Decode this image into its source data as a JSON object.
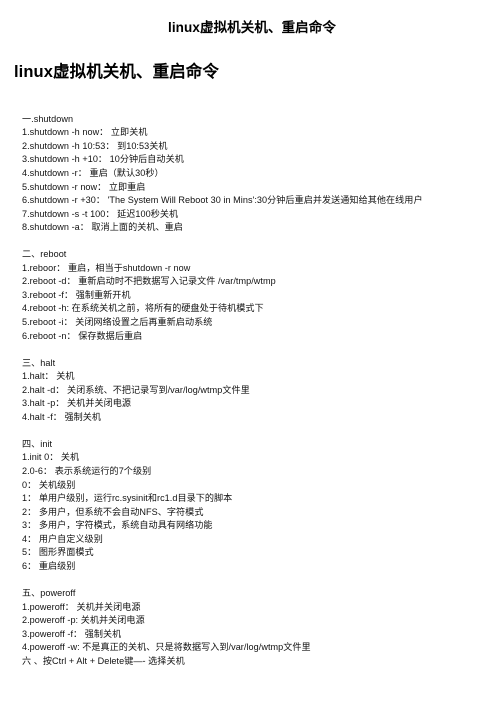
{
  "document": {
    "title": "linux虚拟机关机、重启命令",
    "heading": "linux虚拟机关机、重启命令"
  },
  "content": {
    "lines": [
      "一.shutdown",
      "1.shutdown -h now： 立即关机",
      "2.shutdown -h 10:53： 到10:53关机",
      "3.shutdown -h +10： 10分钟后自动关机",
      "4.shutdown -r： 重启（默认30秒）",
      "5.shutdown -r now： 立即重启",
      "6.shutdown -r +30： 'The System Will Reboot 30 in Mins':30分钟后重启并发送通知给其他在线用户",
      "7.shutdown -s -t 100： 延迟100秒关机",
      "8.shutdown -a： 取消上面的关机、重启",
      "",
      "二、reboot",
      "1.reboor： 重启，相当于shutdown -r now",
      "2.reboot -d： 重新启动时不把数据写入记录文件 /var/tmp/wtmp",
      "3.reboot -f： 强制重新开机",
      "4.reboot -h: 在系统关机之前，将所有的硬盘处于待机模式下",
      "5.reboot -i： 关闭网络设置之后再重新启动系统",
      "6.reboot -n： 保存数据后重启",
      "",
      "三、halt",
      "1.halt： 关机",
      "2.halt -d： 关闭系统、不把记录写到/var/log/wtmp文件里",
      "3.halt -p： 关机并关闭电源",
      "4.halt -f： 强制关机",
      "",
      "四、init",
      "1.init 0： 关机",
      "2.0-6： 表示系统运行的7个级别",
      "0： 关机级别",
      "1： 单用户级别，运行rc.sysinit和rc1.d目录下的脚本",
      "2： 多用户，但系统不会自动NFS、字符模式",
      "3： 多用户，字符模式，系统自动具有网络功能",
      "4： 用户自定义级别",
      "5： 图形界面模式",
      "6： 重启级别",
      "",
      "五、poweroff",
      "1.poweroff： 关机并关闭电源",
      "2.poweroff -p: 关机并关闭电源",
      "3.poweroff -f： 强制关机",
      "4.poweroff -w: 不是真正的关机、只是将数据写入到/var/log/wtmp文件里",
      "六 、按Ctrl + Alt + Delete键—- 选择关机"
    ]
  }
}
